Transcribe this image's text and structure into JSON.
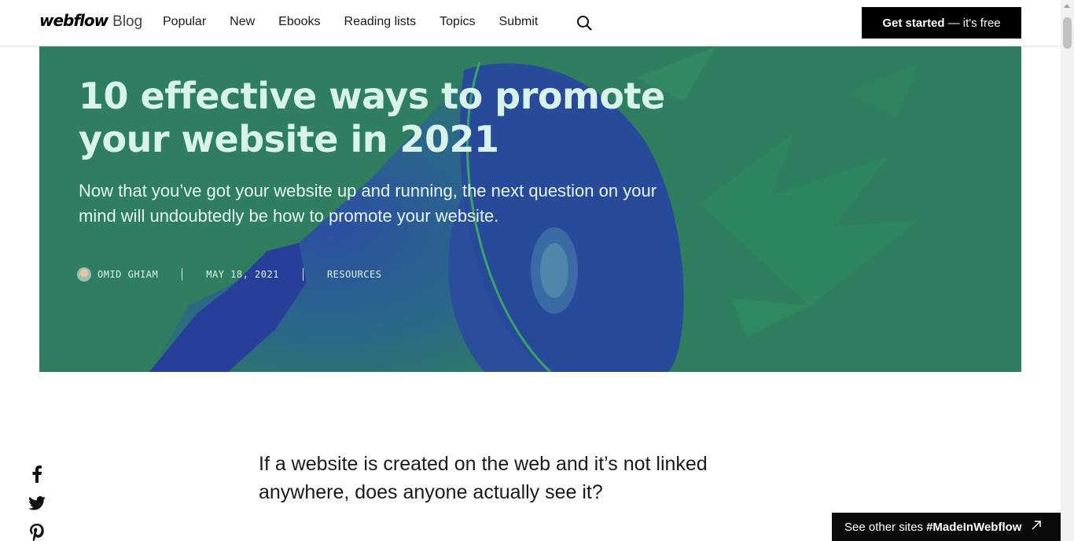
{
  "header": {
    "logo_word": "webflow",
    "logo_suffix": "Blog",
    "nav": [
      "Popular",
      "New",
      "Ebooks",
      "Reading lists",
      "Topics",
      "Submit"
    ],
    "cta_strong": "Get started",
    "cta_rest": "— it's free"
  },
  "hero": {
    "title": "10 effective ways to promote your website in 2021",
    "subtitle": "Now that you’ve got your website up and running, the next question on your mind will undoubtedly be how to promote your website.",
    "author": "OMID GHIAM",
    "date": "MAY 18, 2021",
    "category": "RESOURCES"
  },
  "article": {
    "intro": "If a website is created on the web and it’s not linked anywhere, does anyone actually see it?"
  },
  "badge": {
    "prefix": "See other sites",
    "tag": "#MadeInWebflow"
  },
  "colors": {
    "hero_green": "#2e7e5f",
    "hero_blue": "#27419a",
    "title_text": "#d8f3ea"
  },
  "icons": [
    "search-icon",
    "facebook-icon",
    "twitter-icon",
    "pinterest-icon",
    "external-arrow-icon"
  ]
}
